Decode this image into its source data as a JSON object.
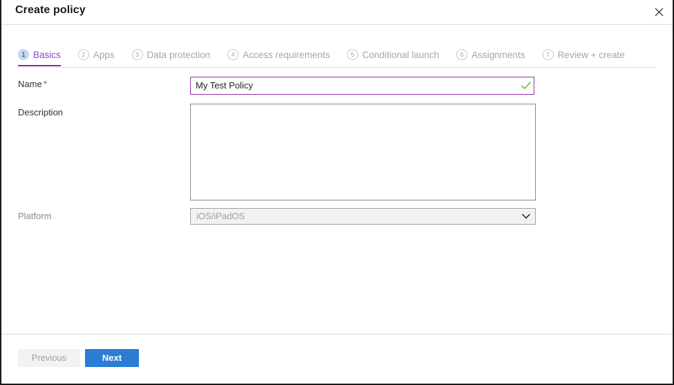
{
  "header": {
    "title": "Create policy",
    "close_icon": "close-icon"
  },
  "tabs": [
    {
      "num": "1",
      "label": "Basics",
      "active": true
    },
    {
      "num": "2",
      "label": "Apps",
      "active": false
    },
    {
      "num": "3",
      "label": "Data protection",
      "active": false
    },
    {
      "num": "4",
      "label": "Access requirements",
      "active": false
    },
    {
      "num": "5",
      "label": "Conditional launch",
      "active": false
    },
    {
      "num": "6",
      "label": "Assignments",
      "active": false
    },
    {
      "num": "7",
      "label": "Review + create",
      "active": false
    }
  ],
  "form": {
    "name": {
      "label": "Name",
      "required_marker": "*",
      "value": "My Test Policy",
      "placeholder": "",
      "valid_icon": "checkmark-icon"
    },
    "description": {
      "label": "Description",
      "value": "",
      "placeholder": ""
    },
    "platform": {
      "label": "Platform",
      "value": "iOS/iPadOS",
      "chevron_icon": "chevron-down-icon"
    }
  },
  "footer": {
    "previous_label": "Previous",
    "next_label": "Next"
  },
  "colors": {
    "accent_purple": "#7b2fa8",
    "primary_blue": "#2b7cd3",
    "valid_green": "#76b043",
    "required_red": "#c0392b",
    "active_tab_circle": "#bfd9f2"
  }
}
